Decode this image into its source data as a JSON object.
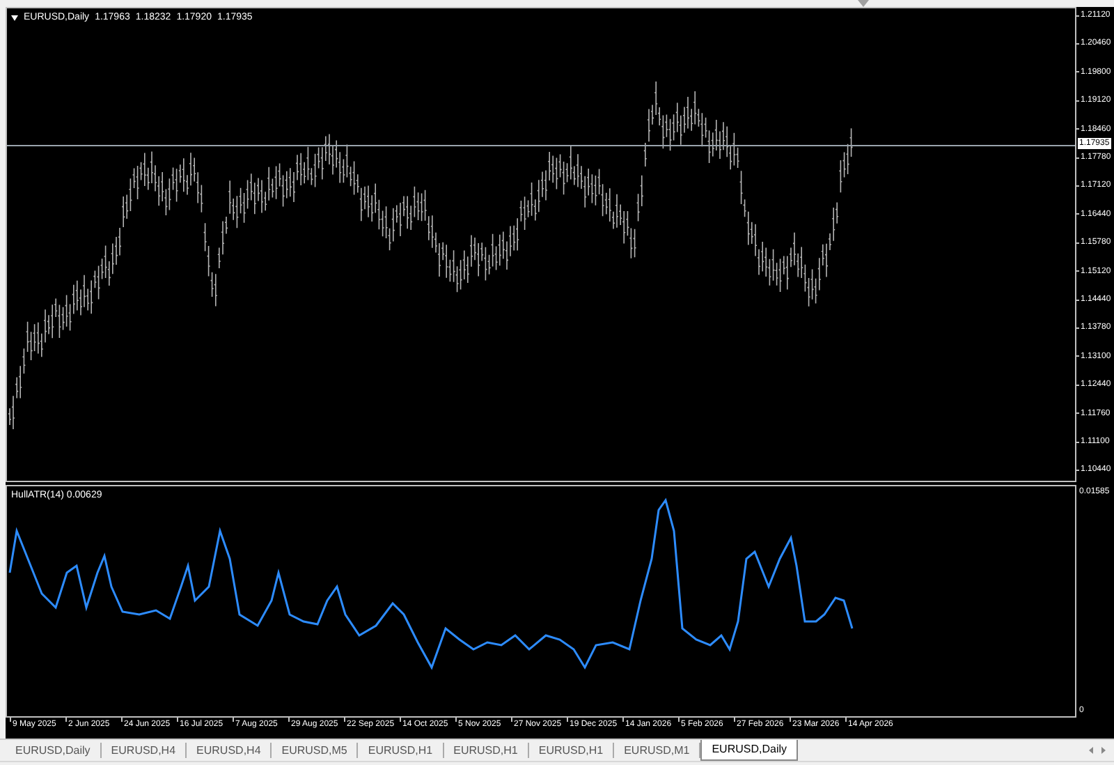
{
  "chart": {
    "symbol": "EURUSD,Daily",
    "ohlc": [
      "1.17963",
      "1.18232",
      "1.17920",
      "1.17935"
    ],
    "current_price": "1.17935",
    "price_ticks": [
      "1.21120",
      "1.20460",
      "1.19800",
      "1.19120",
      "1.18460",
      "1.17780",
      "1.17120",
      "1.16440",
      "1.15780",
      "1.15120",
      "1.14440",
      "1.13780",
      "1.13100",
      "1.12440",
      "1.11760",
      "1.11100",
      "1.10440"
    ],
    "indicator": {
      "label": "HullATR(14) 0.00629",
      "ticks": [
        "0.01585",
        "0"
      ]
    },
    "date_labels": [
      "9 May 2025",
      "2 Jun 2025",
      "24 Jun 2025",
      "16 Jul 2025",
      "7 Aug 2025",
      "29 Aug 2025",
      "22 Sep 2025",
      "14 Oct 2025",
      "5 Nov 2025",
      "27 Nov 2025",
      "19 Dec 2025",
      "14 Jan 2026",
      "5 Feb 2026",
      "27 Feb 2026",
      "23 Mar 2026",
      "14 Apr 2026"
    ]
  },
  "tabs": [
    {
      "label": "EURUSD,Daily",
      "selected": false
    },
    {
      "label": "EURUSD,H4",
      "selected": false
    },
    {
      "label": "EURUSD,H4",
      "selected": false
    },
    {
      "label": "EURUSD,M5",
      "selected": false
    },
    {
      "label": "EURUSD,H1",
      "selected": false
    },
    {
      "label": "EURUSD,H1",
      "selected": false
    },
    {
      "label": "EURUSD,H1",
      "selected": false
    },
    {
      "label": "EURUSD,M1",
      "selected": false
    },
    {
      "label": "EURUSD,Daily",
      "selected": true
    }
  ]
}
